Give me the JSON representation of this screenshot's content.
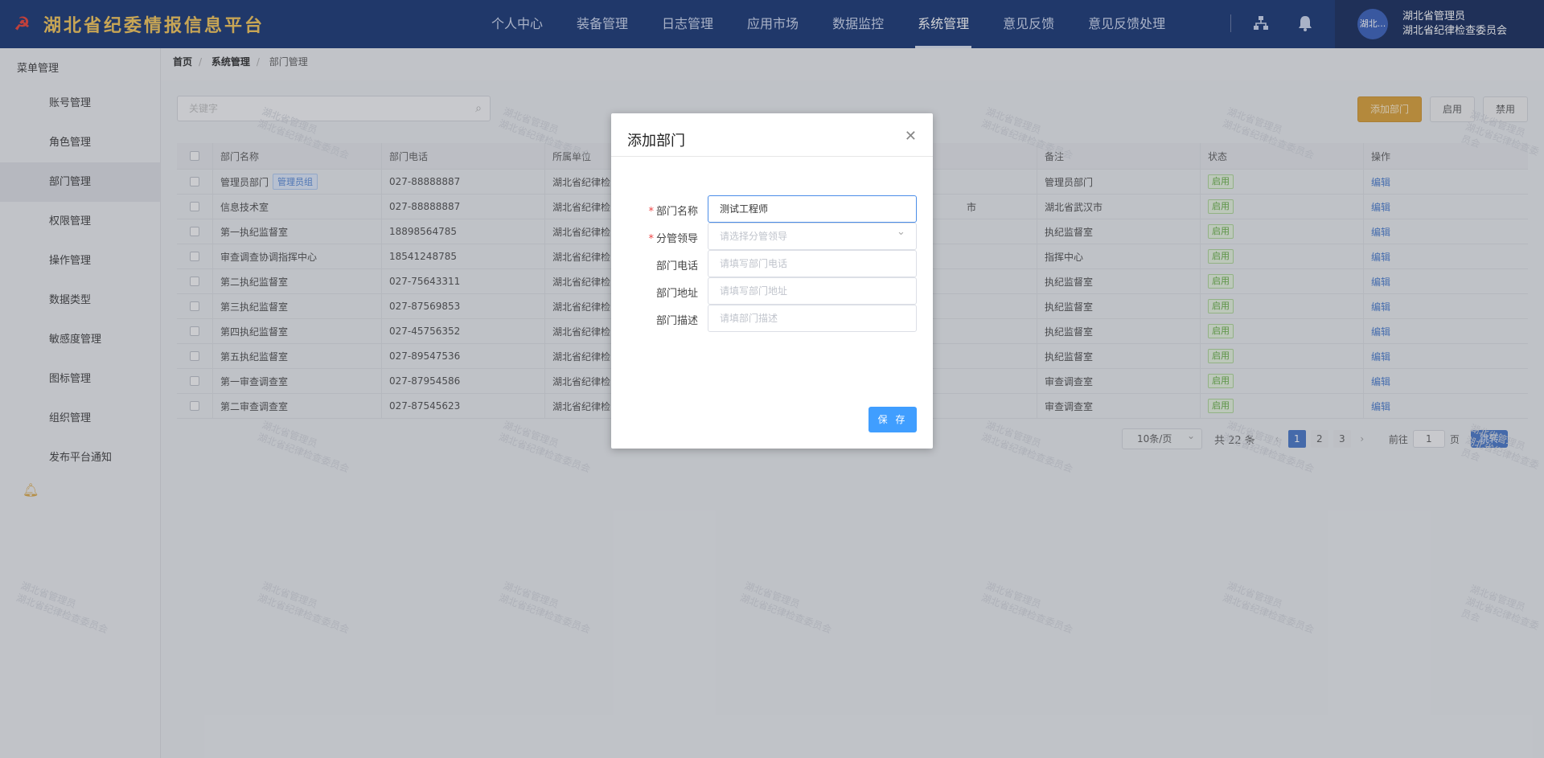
{
  "header": {
    "title": "湖北省纪委情报信息平台",
    "nav": [
      "个人中心",
      "装备管理",
      "日志管理",
      "应用市场",
      "数据监控",
      "系统管理",
      "意见反馈",
      "意见反馈处理"
    ],
    "active_nav": "系统管理",
    "user": {
      "avatar_text": "湖北...",
      "name": "湖北省管理员",
      "org": "湖北省纪律检查委员会"
    }
  },
  "sidebar": {
    "title": "菜单管理",
    "items": [
      "账号管理",
      "角色管理",
      "部门管理",
      "权限管理",
      "操作管理",
      "数据类型",
      "敏感度管理",
      "图标管理",
      "组织管理",
      "发布平台通知"
    ],
    "active": "部门管理"
  },
  "breadcrumb": [
    "首页",
    "系统管理",
    "部门管理"
  ],
  "toolbar": {
    "search_placeholder": "关键字",
    "add_label": "添加部门",
    "enable_label": "启用",
    "disable_label": "禁用"
  },
  "table": {
    "headers": [
      "部门名称",
      "部门电话",
      "所属单位",
      "备注",
      "状态",
      "操作"
    ],
    "rows": [
      {
        "name": "管理员部门",
        "tag": "管理员组",
        "phone": "027-88888887",
        "unit": "湖北省纪律检",
        "unit_tail": "",
        "note": "管理员部门",
        "status": "启用",
        "op": "编辑"
      },
      {
        "name": "信息技术室",
        "tag": "",
        "phone": "027-88888887",
        "unit": "湖北省纪律检",
        "unit_tail": "市",
        "note": "湖北省武汉市",
        "status": "启用",
        "op": "编辑"
      },
      {
        "name": "第一执纪监督室",
        "tag": "",
        "phone": "18898564785",
        "unit": "湖北省纪律检",
        "unit_tail": "",
        "note": "执纪监督室",
        "status": "启用",
        "op": "编辑"
      },
      {
        "name": "审查调查协调指挥中心",
        "tag": "",
        "phone": "18541248785",
        "unit": "湖北省纪律检",
        "unit_tail": "",
        "note": "指挥中心",
        "status": "启用",
        "op": "编辑"
      },
      {
        "name": "第二执纪监督室",
        "tag": "",
        "phone": "027-75643311",
        "unit": "湖北省纪律检",
        "unit_tail": "",
        "note": "执纪监督室",
        "status": "启用",
        "op": "编辑"
      },
      {
        "name": "第三执纪监督室",
        "tag": "",
        "phone": "027-87569853",
        "unit": "湖北省纪律检",
        "unit_tail": "",
        "note": "执纪监督室",
        "status": "启用",
        "op": "编辑"
      },
      {
        "name": "第四执纪监督室",
        "tag": "",
        "phone": "027-45756352",
        "unit": "湖北省纪律检",
        "unit_tail": "",
        "note": "执纪监督室",
        "status": "启用",
        "op": "编辑"
      },
      {
        "name": "第五执纪监督室",
        "tag": "",
        "phone": "027-89547536",
        "unit": "湖北省纪律检",
        "unit_tail": "",
        "note": "执纪监督室",
        "status": "启用",
        "op": "编辑"
      },
      {
        "name": "第一审查调查室",
        "tag": "",
        "phone": "027-87954586",
        "unit": "湖北省纪律检",
        "unit_tail": "",
        "note": "审查调查室",
        "status": "启用",
        "op": "编辑"
      },
      {
        "name": "第二审查调查室",
        "tag": "",
        "phone": "027-87545623",
        "unit": "湖北省纪律检",
        "unit_tail": "",
        "note": "审查调查室",
        "status": "启用",
        "op": "编辑"
      }
    ]
  },
  "pagination": {
    "page_size": "10条/页",
    "total": "共 22 条",
    "pages": [
      "1",
      "2",
      "3"
    ],
    "current": "1",
    "goto_label": "前往",
    "goto_value": "1",
    "page_unit": "页",
    "jump_label": "跳转"
  },
  "watermark": {
    "line1": "湖北省管理员",
    "line2": "湖北省纪律检查委员会"
  },
  "modal": {
    "title": "添加部门",
    "fields": [
      {
        "label": "部门名称",
        "required": true,
        "value": "测试工程师",
        "placeholder": ""
      },
      {
        "label": "分管领导",
        "required": true,
        "value": "",
        "placeholder": "请选择分管领导"
      },
      {
        "label": "部门电话",
        "required": false,
        "value": "",
        "placeholder": "请填写部门电话"
      },
      {
        "label": "部门地址",
        "required": false,
        "value": "",
        "placeholder": "请填写部门地址"
      },
      {
        "label": "部门描述",
        "required": false,
        "value": "",
        "placeholder": "请填部门描述"
      }
    ],
    "save_label": "保 存"
  }
}
